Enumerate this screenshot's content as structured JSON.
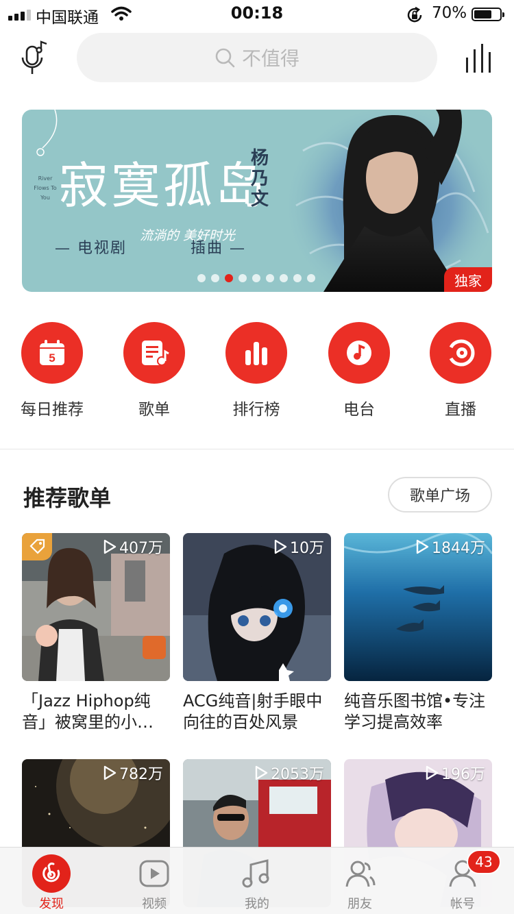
{
  "status_bar": {
    "carrier": "中国联通",
    "time": "00:18",
    "battery": "70%",
    "battery_level": 0.7
  },
  "header": {
    "search_placeholder": "不值得"
  },
  "banner": {
    "title": "寂寞孤岛",
    "artist": "杨乃文",
    "river_text": "River Flows To You",
    "subtitle_left": "— 电视剧",
    "subtitle_script": "流淌的 美好时光",
    "subtitle_right": "插曲 —",
    "badge": "独家",
    "page_count": 9,
    "active_page": 3
  },
  "shortcuts": [
    {
      "label": "每日推荐",
      "icon": "calendar-icon",
      "day": "5"
    },
    {
      "label": "歌单",
      "icon": "playlist-icon"
    },
    {
      "label": "排行榜",
      "icon": "chart-bars-icon"
    },
    {
      "label": "电台",
      "icon": "radio-icon"
    },
    {
      "label": "直播",
      "icon": "live-icon"
    }
  ],
  "section": {
    "title": "推荐歌单",
    "more_button": "歌单广场"
  },
  "playlists": [
    {
      "count": "407万",
      "name": "「Jazz Hiphop纯音」被窝里的小…"
    },
    {
      "count": "10万",
      "name": "ACG纯音|射手眼中向往的百处风景"
    },
    {
      "count": "1844万",
      "name": "纯音乐图书馆•专注学习提高效率"
    },
    {
      "count": "782万",
      "name": ""
    },
    {
      "count": "2053万",
      "name": ""
    },
    {
      "count": "196万",
      "name": ""
    }
  ],
  "tabs": [
    {
      "label": "发现",
      "icon": "netease-music-icon",
      "active": true
    },
    {
      "label": "视频",
      "icon": "video-icon"
    },
    {
      "label": "我的",
      "icon": "music-note-icon"
    },
    {
      "label": "朋友",
      "icon": "friends-icon"
    },
    {
      "label": "帐号",
      "icon": "account-icon"
    }
  ],
  "account_badge": "43",
  "colors": {
    "brand_red": "#e2231a",
    "shortcut_red": "#eb2f26",
    "banner_teal": "#94c6c8"
  }
}
